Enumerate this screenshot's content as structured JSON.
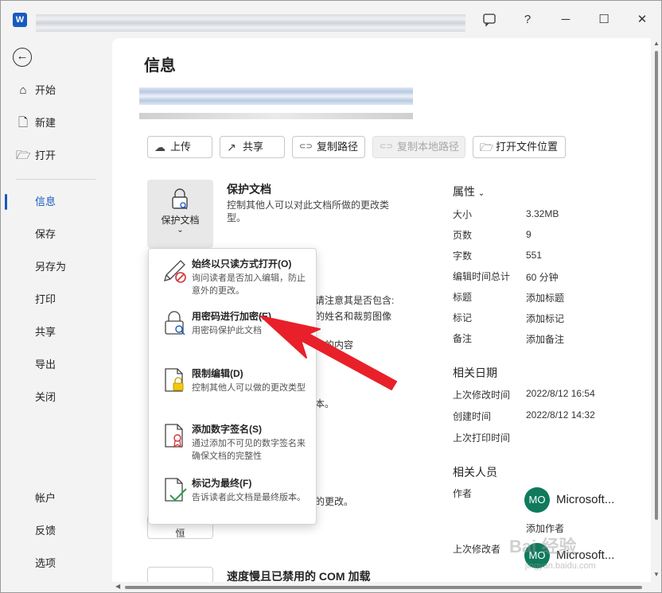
{
  "window": {
    "app_icon": "W",
    "controls": {
      "feedback_icon": "feedback-icon",
      "help": "?",
      "minimize": "─",
      "maximize": "☐",
      "close": "✕"
    }
  },
  "sidebar": {
    "back_glyph": "←",
    "top_items": [
      {
        "label": "开始",
        "icon": "home-icon",
        "glyph": "⌂"
      },
      {
        "label": "新建",
        "icon": "new-document-icon",
        "glyph": "🗋"
      },
      {
        "label": "打开",
        "icon": "open-folder-icon",
        "glyph": "🗁"
      }
    ],
    "items": [
      {
        "label": "信息",
        "active": true
      },
      {
        "label": "保存"
      },
      {
        "label": "另存为"
      },
      {
        "label": "打印"
      },
      {
        "label": "共享"
      },
      {
        "label": "导出"
      },
      {
        "label": "关闭"
      }
    ],
    "bottom_items": [
      {
        "label": "帐户"
      },
      {
        "label": "反馈"
      },
      {
        "label": "选项"
      }
    ]
  },
  "main": {
    "title": "信息",
    "actions": [
      {
        "label": "上传",
        "icon": "upload-icon",
        "glyph": "☁"
      },
      {
        "label": "共享",
        "icon": "share-icon",
        "glyph": "↗"
      },
      {
        "label": "复制路径",
        "icon": "link-icon",
        "glyph": "⊂⊃"
      },
      {
        "label": "复制本地路径",
        "icon": "link-icon",
        "glyph": "⊂⊃",
        "disabled": true
      },
      {
        "label": "打开文件位置",
        "icon": "folder-icon",
        "glyph": "🗁"
      }
    ],
    "protect": {
      "tile_label": "保护文档",
      "chevron": "⌄",
      "heading": "保护文档",
      "description": "控制其他人可以对此文档所做的更改类型。"
    },
    "background_fragments": {
      "inspect_line1": "请注意其是否包含:",
      "inspect_line2": "的姓名和裁剪图像",
      "inspect_line3": "读的内容",
      "version_line": "本。",
      "manage_line": "的更改。",
      "compat_heading": "速度慢且已禁用的 COM 加载",
      "tile_fragment": "恒"
    }
  },
  "dropdown": {
    "items": [
      {
        "title": "始终以只读方式打开(O)",
        "desc": "询问读者是否加入编辑，防止意外的更改。",
        "icon": "pencil-no-icon"
      },
      {
        "title": "用密码进行加密(E)",
        "desc": "用密码保护此文档",
        "icon": "lock-key-icon"
      },
      {
        "title": "限制编辑(D)",
        "desc": "控制其他人可以做的更改类型",
        "icon": "restrict-edit-icon"
      },
      {
        "title": "添加数字签名(S)",
        "desc": "通过添加不可见的数字签名来确保文档的完整性",
        "icon": "certificate-icon"
      },
      {
        "title": "标记为最终(F)",
        "desc": "告诉读者此文档是最终版本。",
        "icon": "mark-final-icon"
      }
    ]
  },
  "properties": {
    "heading": "属性",
    "chevron": "⌄",
    "rows": [
      {
        "label": "大小",
        "value": "3.32MB"
      },
      {
        "label": "页数",
        "value": "9"
      },
      {
        "label": "字数",
        "value": "551"
      },
      {
        "label": "编辑时间总计",
        "value": "60 分钟"
      },
      {
        "label": "标题",
        "value": "添加标题"
      },
      {
        "label": "标记",
        "value": "添加标记"
      },
      {
        "label": "备注",
        "value": "添加备注"
      }
    ],
    "dates_heading": "相关日期",
    "dates": [
      {
        "label": "上次修改时间",
        "value": "2022/8/12 16:54"
      },
      {
        "label": "创建时间",
        "value": "2022/8/12 14:32"
      },
      {
        "label": "上次打印时间",
        "value": ""
      }
    ],
    "people_heading": "相关人员",
    "author_label": "作者",
    "author_initials": "MO",
    "author_name": "Microsoft...",
    "add_author": "添加作者",
    "last_modified_by_label": "上次修改者",
    "last_modified_initials": "MO",
    "last_modified_name": "Microsoft..."
  },
  "watermark": {
    "text": "Bai 经验",
    "sub": "jingyan.baidu.com"
  },
  "annotation": {
    "arrow_color": "#e8202a"
  },
  "colors": {
    "accent": "#185abd",
    "avatar": "#0f7a5c"
  }
}
